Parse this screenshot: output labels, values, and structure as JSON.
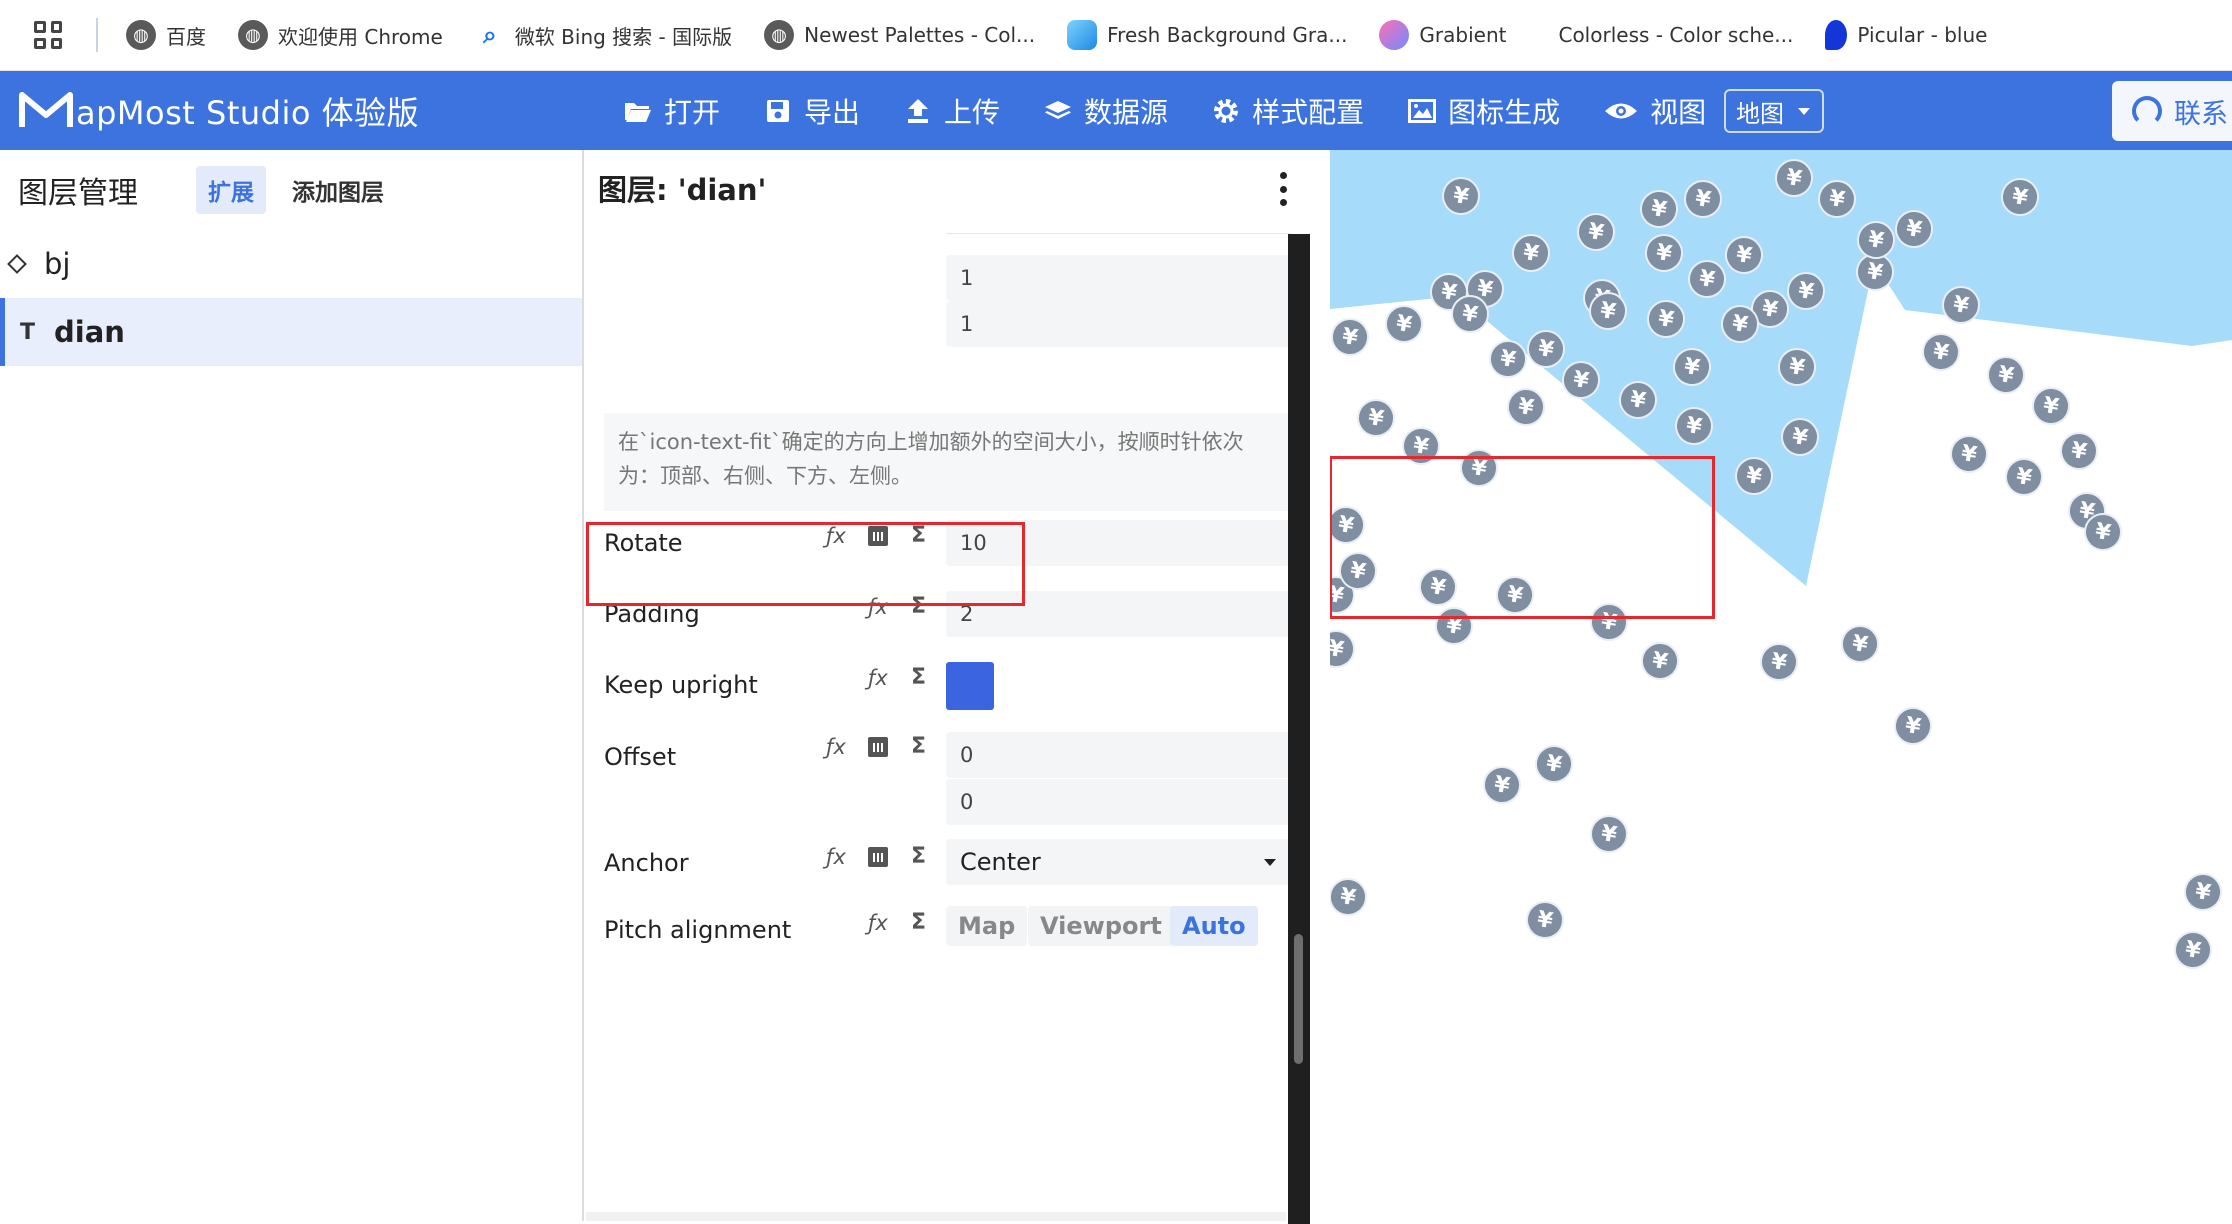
{
  "bookmarks": [
    {
      "label": "百度",
      "icon": "globe-icon"
    },
    {
      "label": "欢迎使用 Chrome",
      "icon": "globe-icon"
    },
    {
      "label": "微软 Bing 搜索 - 国际版",
      "icon": "bing-search-icon"
    },
    {
      "label": "Newest Palettes - Col...",
      "icon": "globe-icon"
    },
    {
      "label": "Fresh Background Gra...",
      "icon": "fresh-icon"
    },
    {
      "label": "Grabient",
      "icon": "grabient-icon"
    },
    {
      "label": "Colorless - Color sche...",
      "icon": "none"
    },
    {
      "label": "Picular - blue",
      "icon": "picular-icon"
    }
  ],
  "app": {
    "brand": "apMost  Studio 体验版",
    "brand_color": "#3c73de",
    "nav": [
      {
        "label": "打开",
        "icon": "folder-open-icon"
      },
      {
        "label": "导出",
        "icon": "save-icon"
      },
      {
        "label": "上传",
        "icon": "upload-icon"
      },
      {
        "label": "数据源",
        "icon": "layers-icon"
      },
      {
        "label": "样式配置",
        "icon": "gear-icon"
      },
      {
        "label": "图标生成",
        "icon": "image-icon"
      },
      {
        "label": "视图",
        "icon": "eye-icon"
      }
    ],
    "view_select": "地图",
    "contact": "联系"
  },
  "layers_panel": {
    "title": "图层管理",
    "tabs": [
      "扩展",
      "添加图层"
    ],
    "active_tab": "扩展",
    "layers": [
      {
        "name": "bj",
        "type_icon": "fill-layer-icon",
        "selected": false
      },
      {
        "name": "dian",
        "type_icon": "T",
        "selected": true
      }
    ]
  },
  "editor": {
    "title": "图层: 'dian'",
    "padding_inputs": [
      "1",
      "1"
    ],
    "description": "在`icon-text-fit`确定的方向上增加额外的空间大小，按顺时针依次为：顶部、右侧、下方、左侧。",
    "properties": {
      "rotate": {
        "label": "Rotate",
        "value": "10"
      },
      "padding": {
        "label": "Padding",
        "value": "2"
      },
      "keep_upright": {
        "label": "Keep upright",
        "checked": true,
        "color": "#3b64e0"
      },
      "offset": {
        "label": "Offset",
        "values": [
          "0",
          "0"
        ]
      },
      "anchor": {
        "label": "Anchor",
        "value": "Center"
      },
      "pitch_alignment": {
        "label": "Pitch alignment",
        "options": [
          "Map",
          "Viewport",
          "Auto"
        ],
        "selected": "Auto"
      }
    },
    "icons": {
      "fx": "ƒx",
      "sigma": "Σ"
    }
  },
  "map": {
    "fill_color": "#a6dbfa",
    "marker_symbol": "¥",
    "marker_color": "#7f8ea0",
    "highlight_color": "#e5282d"
  }
}
